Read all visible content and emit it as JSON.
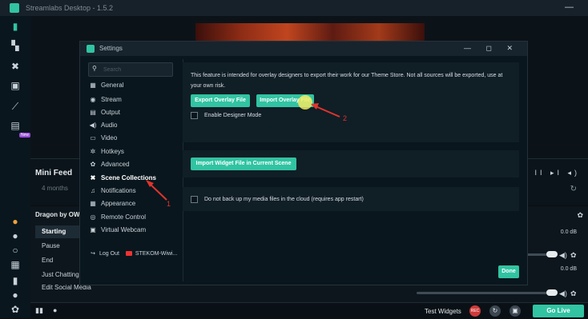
{
  "window": {
    "title": "Streamlabs Desktop - 1.5.2",
    "minimize_symbol": "—"
  },
  "left_nav": {
    "icons": [
      "editor-icon",
      "themes-icon",
      "tools-icon",
      "store-icon",
      "analytics-icon",
      "highlighter-icon"
    ],
    "new_badge": "New"
  },
  "mini_feed": {
    "title": "Mini Feed",
    "ago": "4 months",
    "controls": "▼ II ▸I ◂)",
    "refresh": "↻"
  },
  "scenes": {
    "header": "Dragon by OWN",
    "items": [
      "Starting",
      "Pause",
      "End",
      "Just Chatting",
      "Edit Social Media"
    ]
  },
  "mixer": {
    "values": [
      "0.0 dB",
      "0.0 dB",
      "0.0 dB"
    ]
  },
  "footer": {
    "test_widgets": "Test Widgets",
    "rec": "REC",
    "go_live": "Go Live"
  },
  "settings": {
    "title": "Settings",
    "window_buttons": "— ◻ ✕",
    "search_placeholder": "Search",
    "menu": [
      {
        "icon": "▦",
        "label": "General"
      },
      {
        "icon": "◉",
        "label": "Stream"
      },
      {
        "icon": "▤",
        "label": "Output"
      },
      {
        "icon": "◀)",
        "label": "Audio"
      },
      {
        "icon": "▭",
        "label": "Video"
      },
      {
        "icon": "✲",
        "label": "Hotkeys"
      },
      {
        "icon": "✿",
        "label": "Advanced"
      },
      {
        "icon": "✖",
        "label": "Scene Collections"
      },
      {
        "icon": "♫",
        "label": "Notifications"
      },
      {
        "icon": "▦",
        "label": "Appearance"
      },
      {
        "icon": "◎",
        "label": "Remote Control"
      },
      {
        "icon": "▣",
        "label": "Virtual Webcam"
      }
    ],
    "active_item": "Scene Collections",
    "logout": {
      "label": "Log Out",
      "account": "STEKOM-Wiwi..."
    },
    "overlay_panel": {
      "description": "This feature is intended for overlay designers to export their work for our Theme Store. Not all sources will be exported, use at your own risk.",
      "export_button": "Export Overlay File",
      "import_button": "Import Overlay File",
      "designer_mode_label": "Enable Designer Mode",
      "designer_mode_checked": false
    },
    "widget_panel": {
      "import_widget_button": "Import Widget File in Current Scene"
    },
    "cloud_panel": {
      "backup_label": "Do not back up my media files in the cloud (requires app restart)",
      "checked": false
    },
    "done_button": "Done"
  },
  "annotations": {
    "arrow1_number": "1",
    "arrow2_number": "2",
    "color": "#e0342d"
  },
  "colors": {
    "accent": "#31c3a2",
    "background": "#09161d",
    "annotation": "#e0342d"
  }
}
